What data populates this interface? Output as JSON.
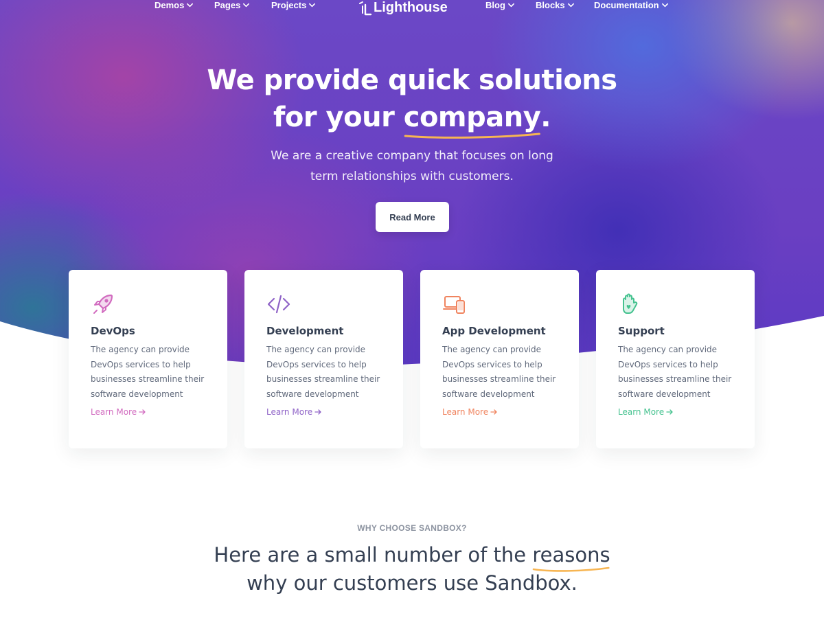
{
  "nav": {
    "left": [
      {
        "label": "Demos"
      },
      {
        "label": "Pages"
      },
      {
        "label": "Projects"
      }
    ],
    "logo": "Lighthouse",
    "right": [
      {
        "label": "Blog"
      },
      {
        "label": "Blocks"
      },
      {
        "label": "Documentation"
      }
    ]
  },
  "hero": {
    "title_line1": "We provide quick solutions",
    "title_line2_pre": "for your ",
    "title_line2_highlight": "company",
    "title_line2_post": ".",
    "subtitle_line1": "We are a creative company that focuses on long",
    "subtitle_line2": "term relationships with customers.",
    "cta_label": "Read More"
  },
  "cards": [
    {
      "icon": "rocket-icon",
      "title": "DevOps",
      "text": "The agency can provide DevOps services to help businesses streamline their software development",
      "link": "Learn More",
      "color": "#d16bbf"
    },
    {
      "icon": "code-icon",
      "title": "Development",
      "text": "The agency can provide DevOps services to help businesses streamline their software development",
      "link": "Learn More",
      "color": "#8f63c7"
    },
    {
      "icon": "devices-icon",
      "title": "App Development",
      "text": "The agency can provide DevOps services to help businesses streamline their software development",
      "link": "Learn More",
      "color": "#f0845f"
    },
    {
      "icon": "hand-heart-icon",
      "title": "Support",
      "text": "The agency can provide DevOps services to help businesses streamline their software development",
      "link": "Learn More",
      "color": "#45c28f"
    }
  ],
  "why": {
    "label": "WHY CHOOSE SANDBOX?",
    "title_line1_pre": "Here are a small number of the ",
    "title_line1_highlight": "reasons",
    "title_line2": "why our customers use Sandbox."
  },
  "colors": {
    "underline_accent": "#f7b552",
    "heading_text": "#343f52",
    "body_text": "#60697b"
  }
}
